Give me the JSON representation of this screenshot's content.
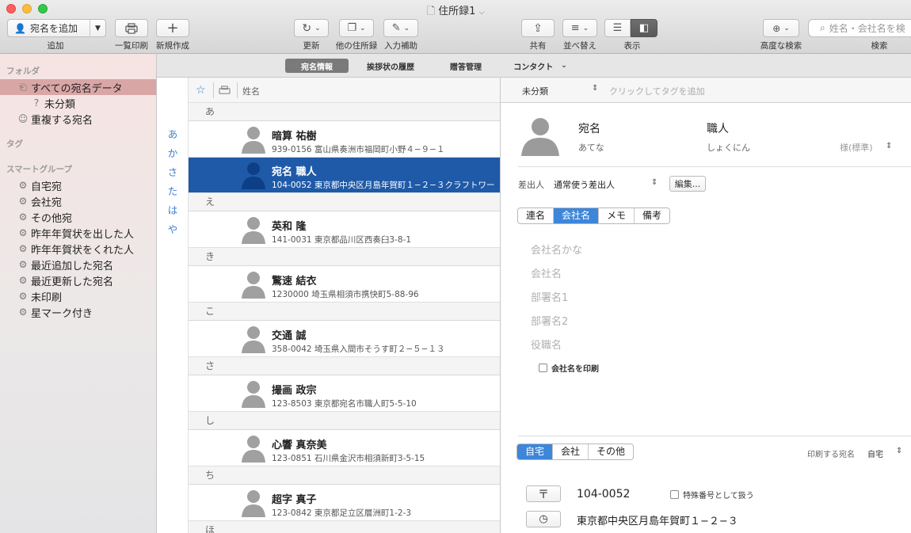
{
  "window": {
    "title": "住所録1"
  },
  "toolbar": {
    "add_button": "宛名を追加",
    "add_label": "追加",
    "print_list_label": "一覧印刷",
    "new_label": "新規作成",
    "update_label": "更新",
    "other_addr_label": "他の住所録",
    "input_assist_label": "入力補助",
    "share_label": "共有",
    "sort_label": "並べ替え",
    "view_label": "表示",
    "adv_search_label": "高度な検索",
    "search_label": "検索",
    "search_placeholder": "姓名・会社名を検"
  },
  "tabs": [
    {
      "label": "宛名情報",
      "active": true
    },
    {
      "label": "挨拶状の履歴",
      "active": false
    },
    {
      "label": "贈答管理",
      "active": false
    },
    {
      "label": "コンタクト",
      "active": false
    }
  ],
  "sidebar": {
    "folder_header": "フォルダ",
    "folders": [
      {
        "label": "すべての宛名データ",
        "icon": "tray-icon",
        "selected": true
      },
      {
        "label": "未分類",
        "icon": "question-icon",
        "selected": false
      },
      {
        "label": "重複する宛名",
        "icon": "people-icon",
        "selected": false
      }
    ],
    "tag_header": "タグ",
    "smart_header": "スマートグループ",
    "smart_groups": [
      "自宅宛",
      "会社宛",
      "その他宛",
      "昨年年賀状を出した人",
      "昨年年賀状をくれた人",
      "最近追加した宛名",
      "最近更新した宛名",
      "未印刷",
      "星マーク付き"
    ]
  },
  "alpha_index": [
    "あ",
    "か",
    "さ",
    "た",
    "は",
    "や"
  ],
  "list": {
    "header_name": "姓名",
    "sections": [
      {
        "kana": "あ",
        "rows": [
          {
            "name": "暗算 祐樹",
            "address": "939-0156 富山県奏洲市福岡町小野４−９−１",
            "selected": false
          },
          {
            "name": "宛名 職人",
            "address": "104-0052 東京都中央区月島年賀町１−２−３クラフトワー…",
            "selected": true
          }
        ]
      },
      {
        "kana": "え",
        "rows": [
          {
            "name": "英和 隆",
            "address": "141-0031 東京都品川区西奏臼3-8-1",
            "selected": false
          }
        ]
      },
      {
        "kana": "き",
        "rows": [
          {
            "name": "驚速 結衣",
            "address": "1230000 埼玉県相須市携快町5-88-96",
            "selected": false
          }
        ]
      },
      {
        "kana": "こ",
        "rows": [
          {
            "name": "交通 誠",
            "address": "358-0042 埼玉県入間市そうす町２−５−１３",
            "selected": false
          }
        ]
      },
      {
        "kana": "さ",
        "rows": [
          {
            "name": "撮画 政宗",
            "address": "123-8503 東京都宛名市職人町5-5-10",
            "selected": false
          }
        ]
      },
      {
        "kana": "し",
        "rows": [
          {
            "name": "心響 真奈美",
            "address": "123-0851 石川県金沢市相須新町3-5-15",
            "selected": false
          }
        ]
      },
      {
        "kana": "ち",
        "rows": [
          {
            "name": "超字 真子",
            "address": "123-0842 東京都足立区層洲町1-2-3",
            "selected": false
          }
        ]
      },
      {
        "kana": "ほ",
        "rows": []
      }
    ]
  },
  "detail": {
    "category": "未分類",
    "tag_placeholder": "クリックしてタグを追加",
    "last_name": "宛名",
    "first_name": "職人",
    "last_kana": "あてな",
    "first_kana": "しょくにん",
    "honorific": "様(標準)",
    "sender_label": "差出人",
    "sender_value": "通常使う差出人",
    "edit_button": "編集...",
    "info_tabs": [
      {
        "label": "連名",
        "on": false
      },
      {
        "label": "会社名",
        "on": true
      },
      {
        "label": "メモ",
        "on": false
      },
      {
        "label": "備考",
        "on": false
      }
    ],
    "company_fields": [
      "会社名かな",
      "会社名",
      "部署名1",
      "部署名2",
      "役職名"
    ],
    "print_company": "会社名を印刷",
    "addr_tabs": [
      {
        "label": "自宅",
        "on": true
      },
      {
        "label": "会社",
        "on": false
      },
      {
        "label": "その他",
        "on": false
      }
    ],
    "print_addr_label": "印刷する宛名",
    "print_addr_value": "自宅",
    "postal_code": "104-0052",
    "special_number": "特殊番号として扱う",
    "address1": "東京都中央区月島年賀町１−２−３"
  }
}
